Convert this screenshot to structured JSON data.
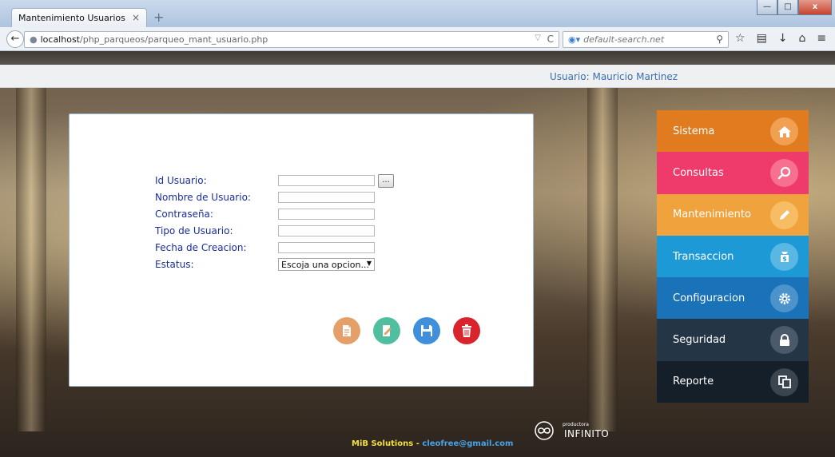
{
  "browser": {
    "tab_title": "Mantenimiento Usuarios",
    "tab_close": "×",
    "new_tab": "+",
    "url_host": "localhost",
    "url_path": "/php_parqueos/parqueo_mant_usuario.php",
    "search_placeholder": "default-search.net"
  },
  "header": {
    "user": "Usuario: Mauricio Martinez"
  },
  "form": {
    "fields": [
      {
        "label": "Id Usuario:",
        "value": ""
      },
      {
        "label": "Nombre de Usuario:",
        "value": ""
      },
      {
        "label": "Contraseña:",
        "value": ""
      },
      {
        "label": "Tipo de Usuario:",
        "value": ""
      },
      {
        "label": "Fecha de Creacion:",
        "value": ""
      },
      {
        "label": "Estatus:",
        "value": "Escoja una opcion..."
      }
    ],
    "lookup_label": "...",
    "actions": [
      {
        "name": "new-document-icon",
        "color": "#e5a06a"
      },
      {
        "name": "edit-document-icon",
        "color": "#4fbf9f"
      },
      {
        "name": "save-icon",
        "color": "#3f8fdc"
      },
      {
        "name": "delete-trash-icon",
        "color": "#d9232d"
      }
    ]
  },
  "menu": {
    "items": [
      {
        "label": "Sistema",
        "icon": "home-icon",
        "bg": "#e07b1f",
        "icon_bg": "#f0a050"
      },
      {
        "label": "Consultas",
        "icon": "search-icon",
        "bg": "#ee3b6c",
        "icon_bg": "#f7708f"
      },
      {
        "label": "Mantenimiento",
        "icon": "pencil-icon",
        "bg": "#f0a23c",
        "icon_bg": "#f6bd64"
      },
      {
        "label": "Transaccion",
        "icon": "money-bag-icon",
        "bg": "#1d9ad6",
        "icon_bg": "#58b8e3"
      },
      {
        "label": "Configuracion",
        "icon": "gear-icon",
        "bg": "#1a72b8",
        "icon_bg": "#4c93cb"
      },
      {
        "label": "Seguridad",
        "icon": "lock-icon",
        "bg": "#243546",
        "icon_bg": "#4a5a6a"
      },
      {
        "label": "Reporte",
        "icon": "copy-icon",
        "bg": "#151f2a",
        "icon_bg": "#3a4550"
      }
    ]
  },
  "footer": {
    "brand": "MiB Solutions",
    "separator": " - ",
    "email": "cleofree@gmail.com",
    "logo_small": "productora",
    "logo_big": "INFINITO"
  }
}
